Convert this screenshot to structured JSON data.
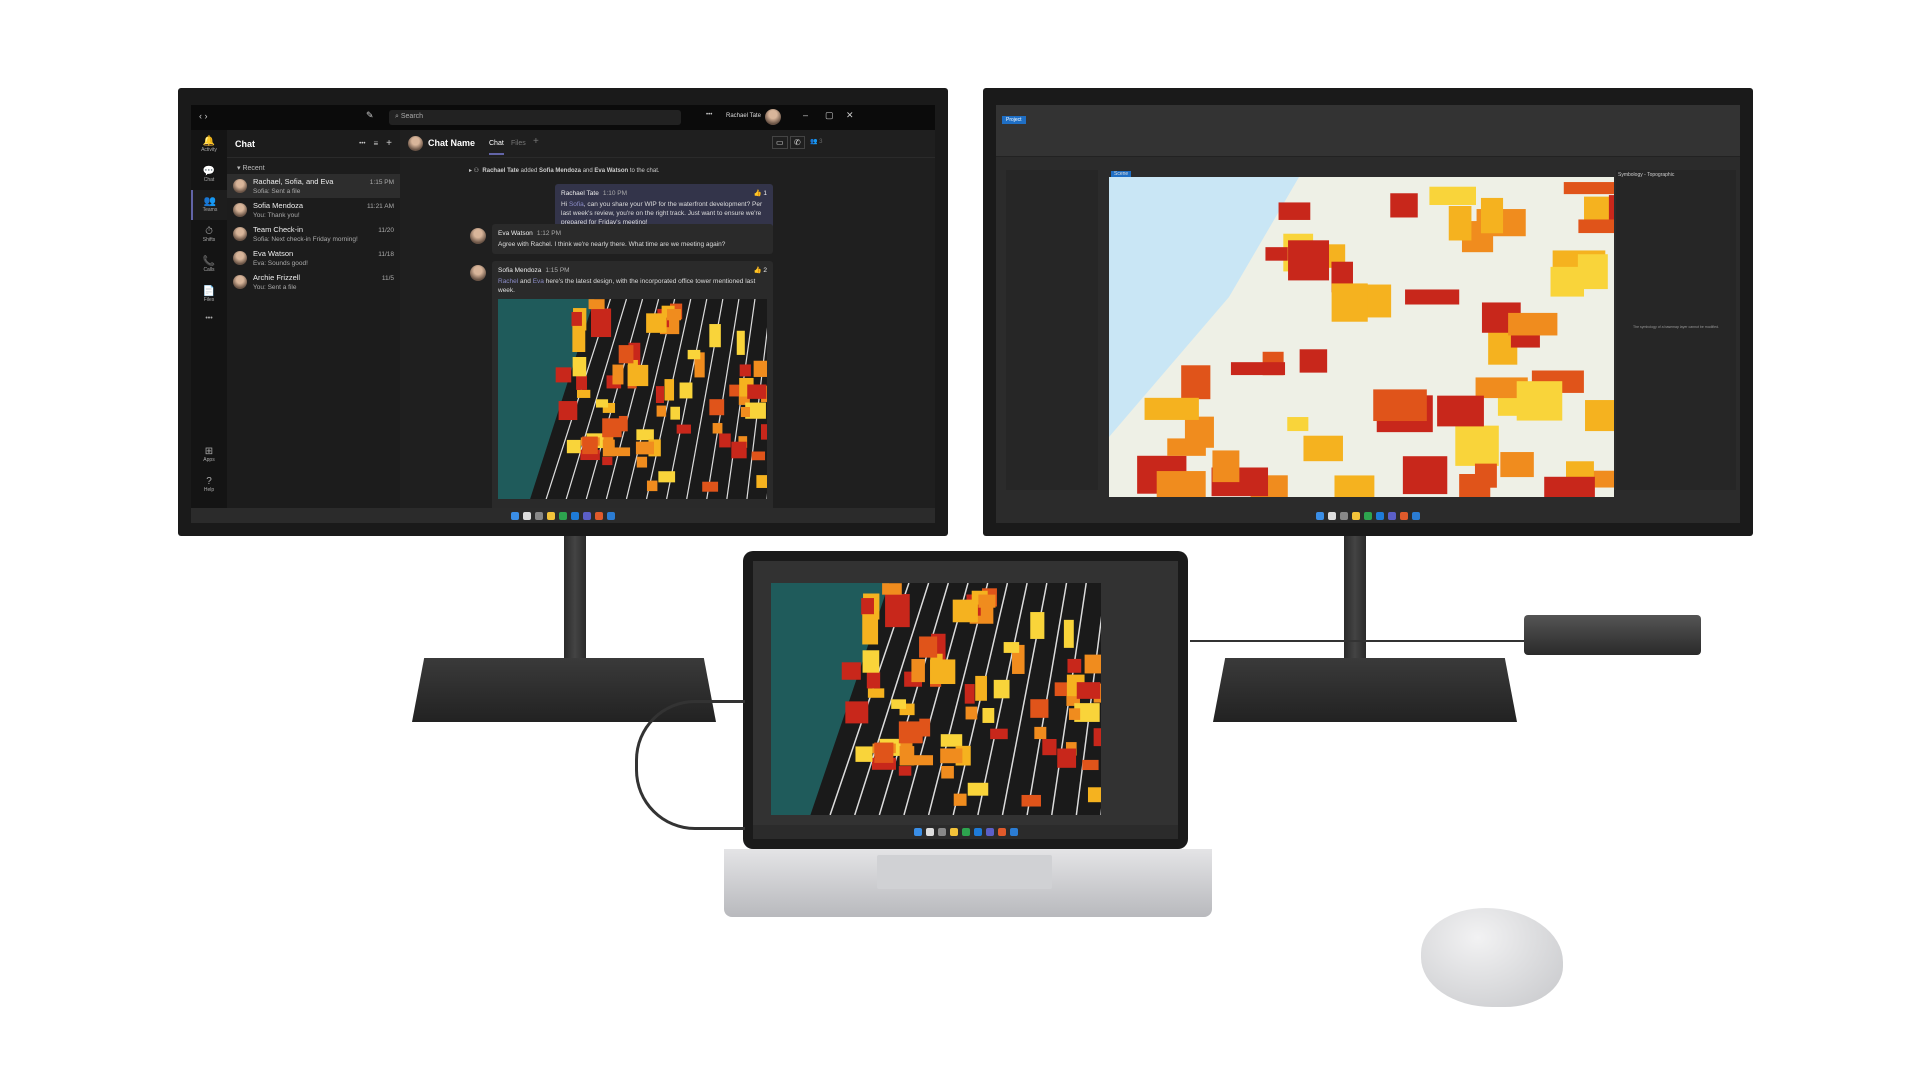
{
  "teams": {
    "search_placeholder": "Search",
    "user_name": "Rachael Tate",
    "rail": [
      {
        "icon": "bell-icon",
        "glyph": "🔔",
        "label": "Activity"
      },
      {
        "icon": "chat-icon",
        "glyph": "💬",
        "label": "Chat"
      },
      {
        "icon": "teams-icon",
        "glyph": "👥",
        "label": "Teams"
      },
      {
        "icon": "shifts-icon",
        "glyph": "⏱",
        "label": "Shifts"
      },
      {
        "icon": "calls-icon",
        "glyph": "📞",
        "label": "Calls"
      },
      {
        "icon": "files-icon",
        "glyph": "📄",
        "label": "Files"
      }
    ],
    "rail_bottom": [
      {
        "label": "Apps",
        "glyph": "⊞"
      },
      {
        "label": "Help",
        "glyph": "?"
      }
    ],
    "more": "•••",
    "list_title": "Chat",
    "section": "Recent",
    "chats": [
      {
        "name": "Rachael, Sofia, and Eva",
        "preview": "Sofia: Sent a file",
        "time": "1:15 PM"
      },
      {
        "name": "Sofia Mendoza",
        "preview": "You: Thank you!",
        "time": "11:21 AM"
      },
      {
        "name": "Team Check-in",
        "preview": "Sofia: Next check-in Friday morning!",
        "time": "11/20"
      },
      {
        "name": "Eva Watson",
        "preview": "Eva: Sounds good!",
        "time": "11/18"
      },
      {
        "name": "Archie Frizzell",
        "preview": "You: Sent a file",
        "time": "11/5"
      }
    ],
    "chat_name": "Chat Name",
    "tabs": [
      "Chat",
      "Files"
    ],
    "participants": "3",
    "system_msg": {
      "actor": "Rachael Tate",
      "added": "added",
      "a": "Sofia Mendoza",
      "and": "and",
      "b": "Eva Watson",
      "tail": "to the chat."
    },
    "messages": [
      {
        "author": "Rachael Tate",
        "time": "1:10 PM",
        "pre": "Hi ",
        "mention": "Sofia",
        "text": ", can you share your WIP for the waterfront development? Per last week's review, you're on the right track. Just want to ensure we're prepared for Friday's meeting!",
        "reactions": "👍 1"
      },
      {
        "author": "Eva Watson",
        "time": "1:12 PM",
        "text": "Agree with Rachel. I think we're nearly there. What time are we meeting again?"
      },
      {
        "author": "Sofia Mendoza",
        "time": "1:15 PM",
        "m1": "Rachel",
        "and": " and ",
        "m2": "Eva",
        "text": " here's the latest design, with the incorporated office tower mentioned last week.",
        "reactions": "👍 2"
      }
    ]
  },
  "arcgis": {
    "pane_title": "Symbology - Topographic",
    "note": "The symbology of a basemap layer cannot be modified.",
    "tab": "Project",
    "scene_tab": "Scene"
  },
  "colors": {
    "accent": "#6264a7",
    "buildings": [
      "#c8271b",
      "#e0541a",
      "#f08c1e",
      "#f5b21f",
      "#f9d43a"
    ],
    "water": "#c9e6f5",
    "land": "#eef0e6"
  }
}
